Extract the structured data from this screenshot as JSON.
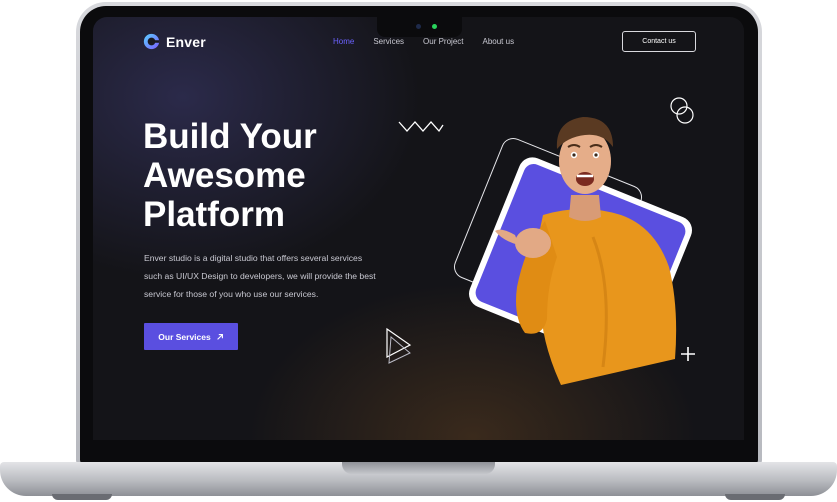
{
  "brand": {
    "name": "Enver"
  },
  "nav": {
    "items": [
      {
        "label": "Home",
        "active": true
      },
      {
        "label": "Services",
        "active": false
      },
      {
        "label": "Our Project",
        "active": false
      },
      {
        "label": "About us",
        "active": false
      }
    ],
    "contact_label": "Contact us"
  },
  "hero": {
    "title_lines": [
      "Build Your",
      "Awesome",
      "Platform"
    ],
    "description_lines": [
      "Enver studio is a digital studio that offers several services",
      "such as UI/UX Design to developers, we will provide the best",
      "service for those of you who use our services."
    ],
    "cta_label": "Our Services",
    "cta_icon": "arrow-up-right-icon"
  },
  "colors": {
    "accent": "#5a4fe0",
    "nav_active": "#6b62ff",
    "background": "#141418",
    "shirt": "#e8961c"
  }
}
